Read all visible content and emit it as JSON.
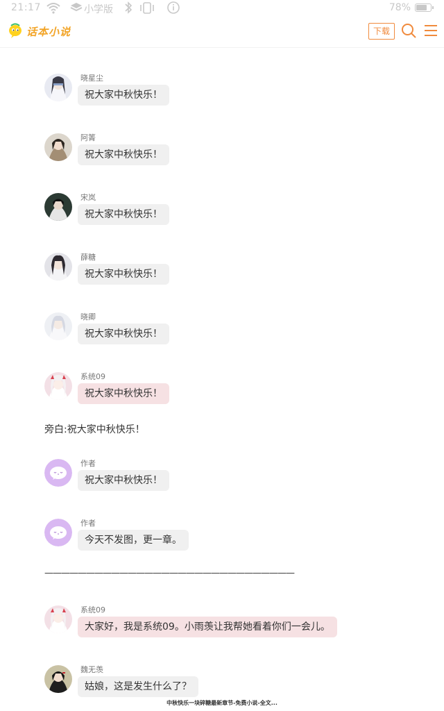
{
  "status_bar": {
    "time": "21:17",
    "app_label": "小学版",
    "battery_percent": "78%",
    "battery_level": 0.78
  },
  "header": {
    "logo_text": "话本小说",
    "download_label": "下载",
    "accent_color": "#f08a3c"
  },
  "messages": [
    {
      "name": "晓星尘",
      "text": "祝大家中秋快乐！",
      "bubble": "gray"
    },
    {
      "name": "阿箐",
      "text": "祝大家中秋快乐！",
      "bubble": "gray"
    },
    {
      "name": "宋岚",
      "text": "祝大家中秋快乐！",
      "bubble": "gray"
    },
    {
      "name": "薛糖",
      "text": "祝大家中秋快乐！",
      "bubble": "gray"
    },
    {
      "name": "晓卿",
      "text": "祝大家中秋快乐！",
      "bubble": "gray"
    },
    {
      "name": "系统09",
      "text": "祝大家中秋快乐！",
      "bubble": "pink"
    },
    {
      "name": "作者",
      "text": "祝大家中秋快乐！",
      "bubble": "gray"
    },
    {
      "name": "作者",
      "text": "今天不发图，更一章。",
      "bubble": "gray"
    },
    {
      "name": "系统09",
      "text": "大家好，我是系统09。小雨羡让我帮她看着你们一会儿。",
      "bubble": "pink"
    },
    {
      "name": "魏无羡",
      "text": "姑娘，这是发生什么了？",
      "bubble": "gray"
    }
  ],
  "narration": "旁白:祝大家中秋快乐！",
  "divider": "——————————————————————————————",
  "footer_title": "中秋快乐一块碎糖最新章节-免费小说-全文..."
}
